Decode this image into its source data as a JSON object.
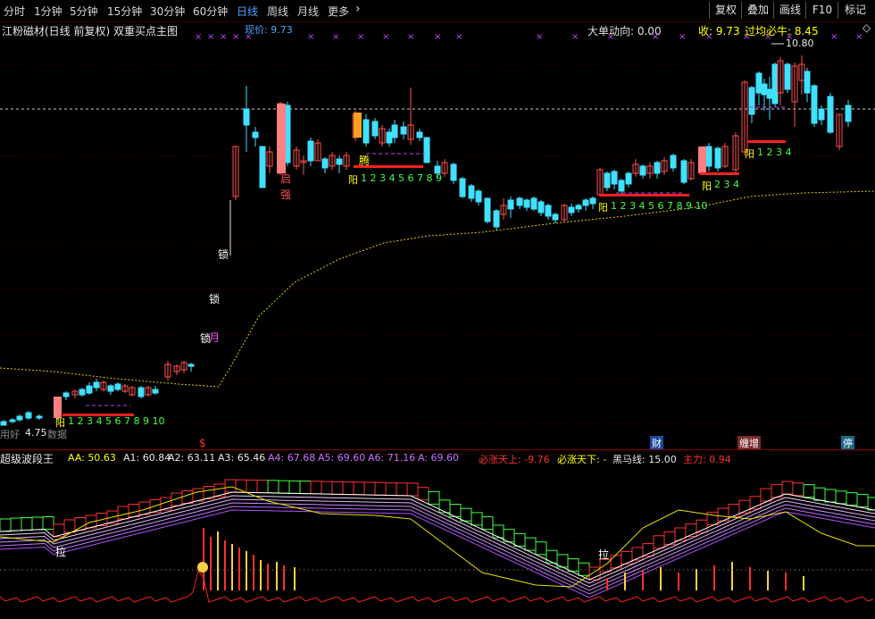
{
  "toolbar": {
    "periods": [
      "分时",
      "1分钟",
      "5分钟",
      "15分钟",
      "30分钟",
      "60分钟",
      "日线",
      "周线",
      "月线",
      "更多"
    ],
    "more_chevron": "›",
    "active_period": "日线",
    "tools": [
      "复权",
      "叠加",
      "画线",
      "F10",
      "标记"
    ]
  },
  "main_chart": {
    "title": "江粉磁材(日线 前复权) 双重买点主图",
    "current_price_label": "现价: 9.73",
    "big_order_label": "大单动向: 0.00",
    "close_label": "收: 9.73",
    "break_label": "过均必牛: 8.45",
    "high_label": "10.80",
    "low_label": "4.75",
    "low_prefix": "用好",
    "low_suffix": "数据",
    "annotations": {
      "lock1": "锁",
      "lock2": "锁",
      "lock3": "锁",
      "month": "月",
      "qi": "启",
      "qiang": "强",
      "teng": "腾",
      "yang": "阳",
      "count_10": "1 2 3 4 5 6 7 8 9 10",
      "count_9": "1 2 3 4 5 6 7 8 9",
      "count_4": "1 2 3 4",
      "count_3": "2 3 4",
      "dollar": "$",
      "cai": "财",
      "chengzeng": "缠增",
      "ting": "停"
    }
  },
  "indicator": {
    "title": "超级波段王",
    "items": [
      {
        "label": "AA: 50.63",
        "color": "#ffff00"
      },
      {
        "label": "A1: 60.84",
        "color": "#e8e8e8"
      },
      {
        "label": "A2: 63.11",
        "color": "#e8e8e8"
      },
      {
        "label": "A3: 65.46",
        "color": "#e8e8e8"
      },
      {
        "label": "A4: 67.68",
        "color": "#d070ff"
      },
      {
        "label": "A5: 69.60",
        "color": "#d070ff"
      },
      {
        "label": "A6: 71.16",
        "color": "#d070ff"
      },
      {
        "label": "A: 69.60",
        "color": "#d070ff"
      },
      {
        "label": "必涨天上: -9.76",
        "color": "#ff3030"
      },
      {
        "label": "必涨天下: -",
        "color": "#ffff00"
      },
      {
        "label": "黑马线: 15.00",
        "color": "#e8e8e8"
      },
      {
        "label": "主力: 0.94",
        "color": "#ff3030"
      }
    ],
    "marks": {
      "la1": "拉",
      "la2": "拉"
    }
  },
  "colors": {
    "up": "#ff5050",
    "down": "#40e0ff",
    "bg": "#000000",
    "grid": "#7a0000",
    "accent": "#4fa3ff"
  }
}
